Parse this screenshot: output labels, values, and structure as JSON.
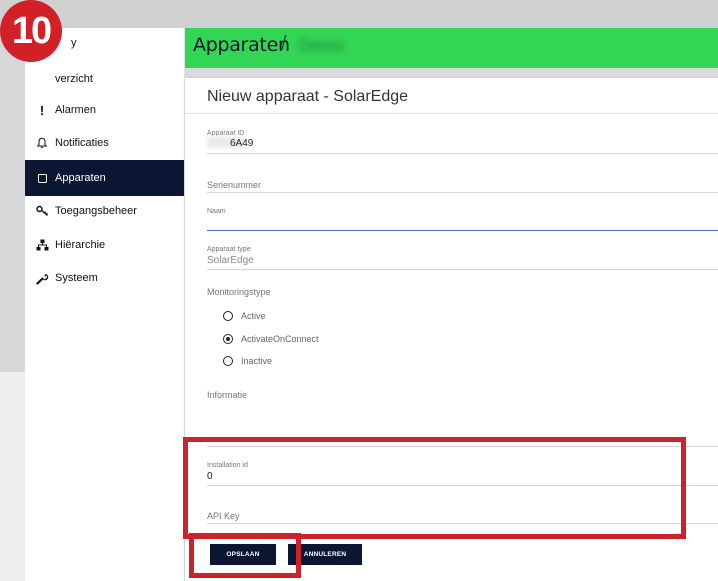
{
  "step_badge": "10",
  "sidebar": {
    "partial_top": "y",
    "partial_overview": "verzicht",
    "items": [
      {
        "label": "Alarmen",
        "icon": "exclamation-icon"
      },
      {
        "label": "Notificaties",
        "icon": "bell-icon"
      },
      {
        "label": "Apparaten",
        "icon": "device-icon",
        "active": true
      },
      {
        "label": "Toegangsbeheer",
        "icon": "key-icon"
      },
      {
        "label": "Hiërarchie",
        "icon": "hierarchy-icon"
      },
      {
        "label": "Systeem",
        "icon": "wrench-icon"
      }
    ]
  },
  "header": {
    "title": "Apparaten",
    "separator": "/",
    "crumb": "Demo",
    "color": "#33d654"
  },
  "form": {
    "title": "Nieuw apparaat - SolarEdge",
    "device_id_label": "Apparaat ID",
    "device_id_value": "6A49",
    "serial_label": "Serienummer",
    "name_label": "Naam",
    "device_type_label": "Apparaat type",
    "device_type_value": "SolarEdge",
    "monitoring_label": "Monitoringstype",
    "monitoring_options": [
      "Active",
      "ActivateOnConnect",
      "Inactive"
    ],
    "monitoring_selected": "ActivateOnConnect",
    "info_label": "Informatie",
    "installation_id_label": "Installation id",
    "installation_id_value": "0",
    "api_key_label": "API Key",
    "save_label": "OPSLAAN",
    "cancel_label": "ANNULEREN"
  },
  "colors": {
    "nav_active": "#0b1633",
    "highlight": "#cc2229",
    "badge": "#d32027"
  }
}
